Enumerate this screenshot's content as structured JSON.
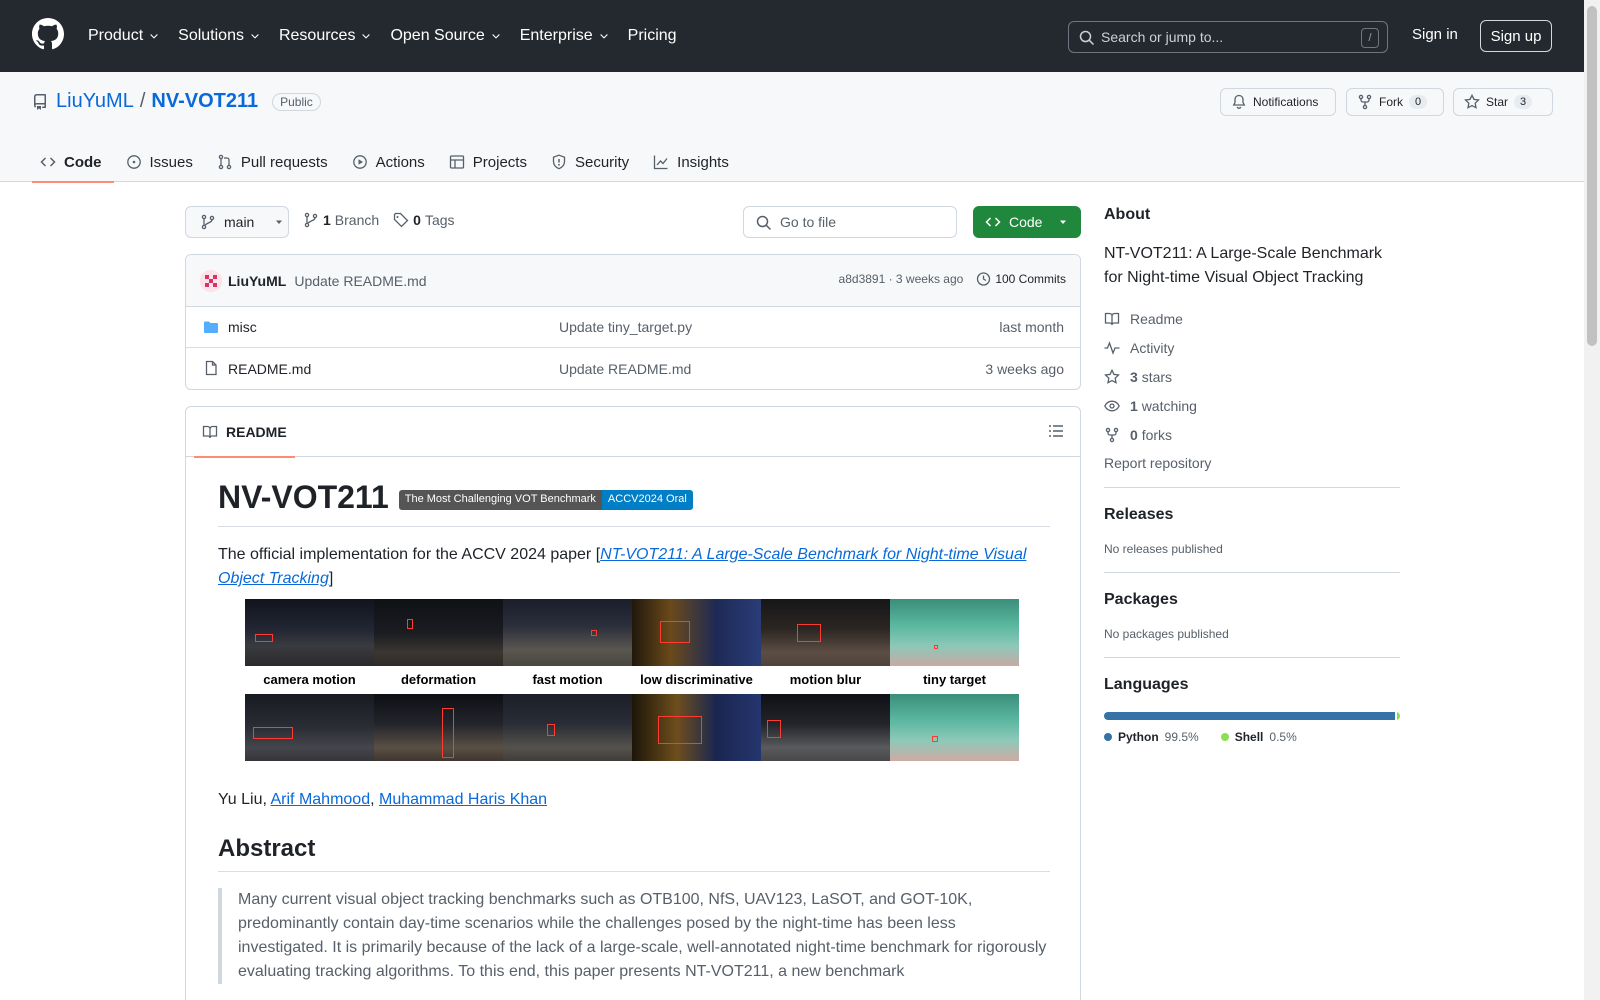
{
  "header": {
    "nav": [
      {
        "label": "Product",
        "has_menu": true
      },
      {
        "label": "Solutions",
        "has_menu": true
      },
      {
        "label": "Resources",
        "has_menu": true
      },
      {
        "label": "Open Source",
        "has_menu": true
      },
      {
        "label": "Enterprise",
        "has_menu": true
      },
      {
        "label": "Pricing",
        "has_menu": false
      }
    ],
    "search_placeholder": "Search or jump to...",
    "search_shortcut": "/",
    "sign_in": "Sign in",
    "sign_up": "Sign up"
  },
  "repo": {
    "owner": "LiuYuML",
    "separator": "/",
    "name": "NV-VOT211",
    "visibility": "Public",
    "notifications_label": "Notifications",
    "fork_label": "Fork",
    "fork_count": "0",
    "star_label": "Star",
    "star_count": "3",
    "tabs": [
      {
        "label": "Code",
        "icon": "code-icon",
        "active": true
      },
      {
        "label": "Issues",
        "icon": "issue-icon",
        "active": false
      },
      {
        "label": "Pull requests",
        "icon": "pull-request-icon",
        "active": false
      },
      {
        "label": "Actions",
        "icon": "play-icon",
        "active": false
      },
      {
        "label": "Projects",
        "icon": "table-icon",
        "active": false
      },
      {
        "label": "Security",
        "icon": "shield-icon",
        "active": false
      },
      {
        "label": "Insights",
        "icon": "graph-icon",
        "active": false
      }
    ]
  },
  "toolbar": {
    "branch": "main",
    "branch_count": "1",
    "branch_word": "Branch",
    "tag_count": "0",
    "tag_word": "Tags",
    "goto_placeholder": "Go to file",
    "code_button": "Code"
  },
  "commit": {
    "author": "LiuYuML",
    "message": "Update README.md",
    "sha_time": "a8d3891 · 3 weeks ago",
    "commits": "100 Commits"
  },
  "files": [
    {
      "name": "misc",
      "type": "folder",
      "message": "Update tiny_target.py",
      "date": "last month"
    },
    {
      "name": "README.md",
      "type": "file",
      "message": "Update README.md",
      "date": "3 weeks ago"
    }
  ],
  "readme": {
    "tab": "README",
    "title": "NV-VOT211",
    "shield_left": "The Most Challenging VOT Benchmark",
    "shield_right": "ACCV2024 Oral",
    "intro_prefix": "The official implementation for the ACCV 2024 paper [",
    "intro_link": "NT-VOT211: A Large-Scale Benchmark for Night-time Visual Object Tracking",
    "intro_suffix": "]",
    "image_labels": [
      "camera motion",
      "deformation",
      "fast motion",
      "low discriminative",
      "motion blur",
      "tiny target"
    ],
    "authors_plain": "Yu Liu, ",
    "author_links": [
      "Arif Mahmood",
      "Muhammad Haris Khan"
    ],
    "author_sep": ", ",
    "abstract_heading": "Abstract",
    "abstract_text": "Many current visual object tracking benchmarks such as OTB100, NfS, UAV123, LaSOT, and GOT-10K, predominantly contain day-time scenarios while the challenges posed by the night-time has been less investigated. It is primarily because of the lack of a large-scale, well-annotated night-time benchmark for rigorously evaluating tracking algorithms. To this end, this paper presents NT-VOT211, a new benchmark"
  },
  "sidebar": {
    "about_heading": "About",
    "description": "NT-VOT211: A Large-Scale Benchmark for Night-time Visual Object Tracking",
    "items": [
      {
        "icon": "book-icon",
        "count": "",
        "label": "Readme"
      },
      {
        "icon": "pulse-icon",
        "count": "",
        "label": "Activity"
      },
      {
        "icon": "star-icon",
        "count": "3",
        "label": "stars"
      },
      {
        "icon": "eye-icon",
        "count": "1",
        "label": "watching"
      },
      {
        "icon": "fork-icon",
        "count": "0",
        "label": "forks"
      }
    ],
    "report": "Report repository",
    "releases_heading": "Releases",
    "releases_empty": "No releases published",
    "packages_heading": "Packages",
    "packages_empty": "No packages published",
    "languages_heading": "Languages",
    "languages": [
      {
        "name": "Python",
        "percent": "99.5%",
        "fraction": 0.995,
        "color": "#3572A5"
      },
      {
        "name": "Shell",
        "percent": "0.5%",
        "fraction": 0.005,
        "color": "#89e051"
      }
    ]
  },
  "colors": {
    "header_bg": "#24292f",
    "link": "#0969da",
    "primary_button": "#1f883d",
    "active_tab_underline": "#fd8c73"
  }
}
